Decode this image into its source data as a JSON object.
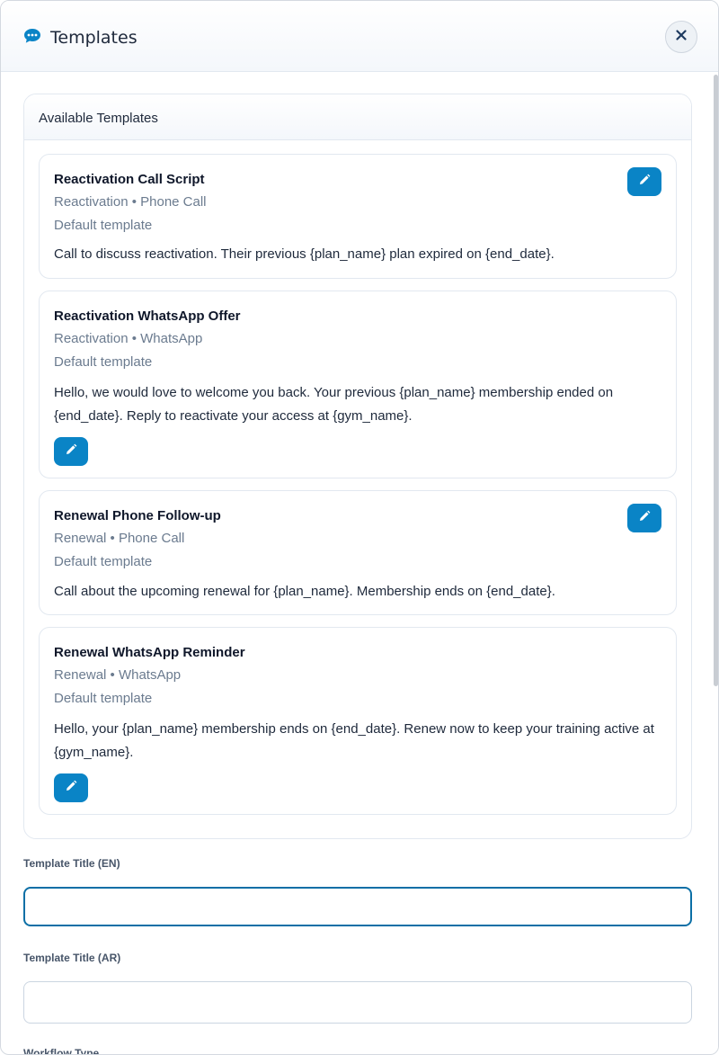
{
  "modal": {
    "title": "Templates",
    "header_icon": "chat-bubble-icon",
    "close_icon": "close-icon"
  },
  "panel": {
    "title": "Available Templates"
  },
  "templates": [
    {
      "title": "Reactivation Call Script",
      "meta": "Reactivation • Phone Call",
      "default_label": "Default template",
      "body": "Call to discuss reactivation. Their previous {plan_name} plan expired on {end_date}."
    },
    {
      "title": "Reactivation WhatsApp Offer",
      "meta": "Reactivation • WhatsApp",
      "default_label": "Default template",
      "body": "Hello, we would love to welcome you back. Your previous {plan_name} membership ended on {end_date}. Reply to reactivate your access at {gym_name}."
    },
    {
      "title": "Renewal Phone Follow-up",
      "meta": "Renewal • Phone Call",
      "default_label": "Default template",
      "body": "Call about the upcoming renewal for {plan_name}. Membership ends on {end_date}."
    },
    {
      "title": "Renewal WhatsApp Reminder",
      "meta": "Renewal • WhatsApp",
      "default_label": "Default template",
      "body": "Hello, your {plan_name} membership ends on {end_date}. Renew now to keep your training active at {gym_name}."
    }
  ],
  "form": {
    "title_en_label": "Template Title (EN)",
    "title_en_value": "",
    "title_ar_label": "Template Title (AR)",
    "title_ar_value": "",
    "workflow_type_label": "Workflow Type"
  },
  "colors": {
    "accent": "#0a84c6",
    "focus_border": "#0b6fa6",
    "muted_text": "#6b7b8f"
  },
  "icons": {
    "edit": "pencil-icon"
  }
}
